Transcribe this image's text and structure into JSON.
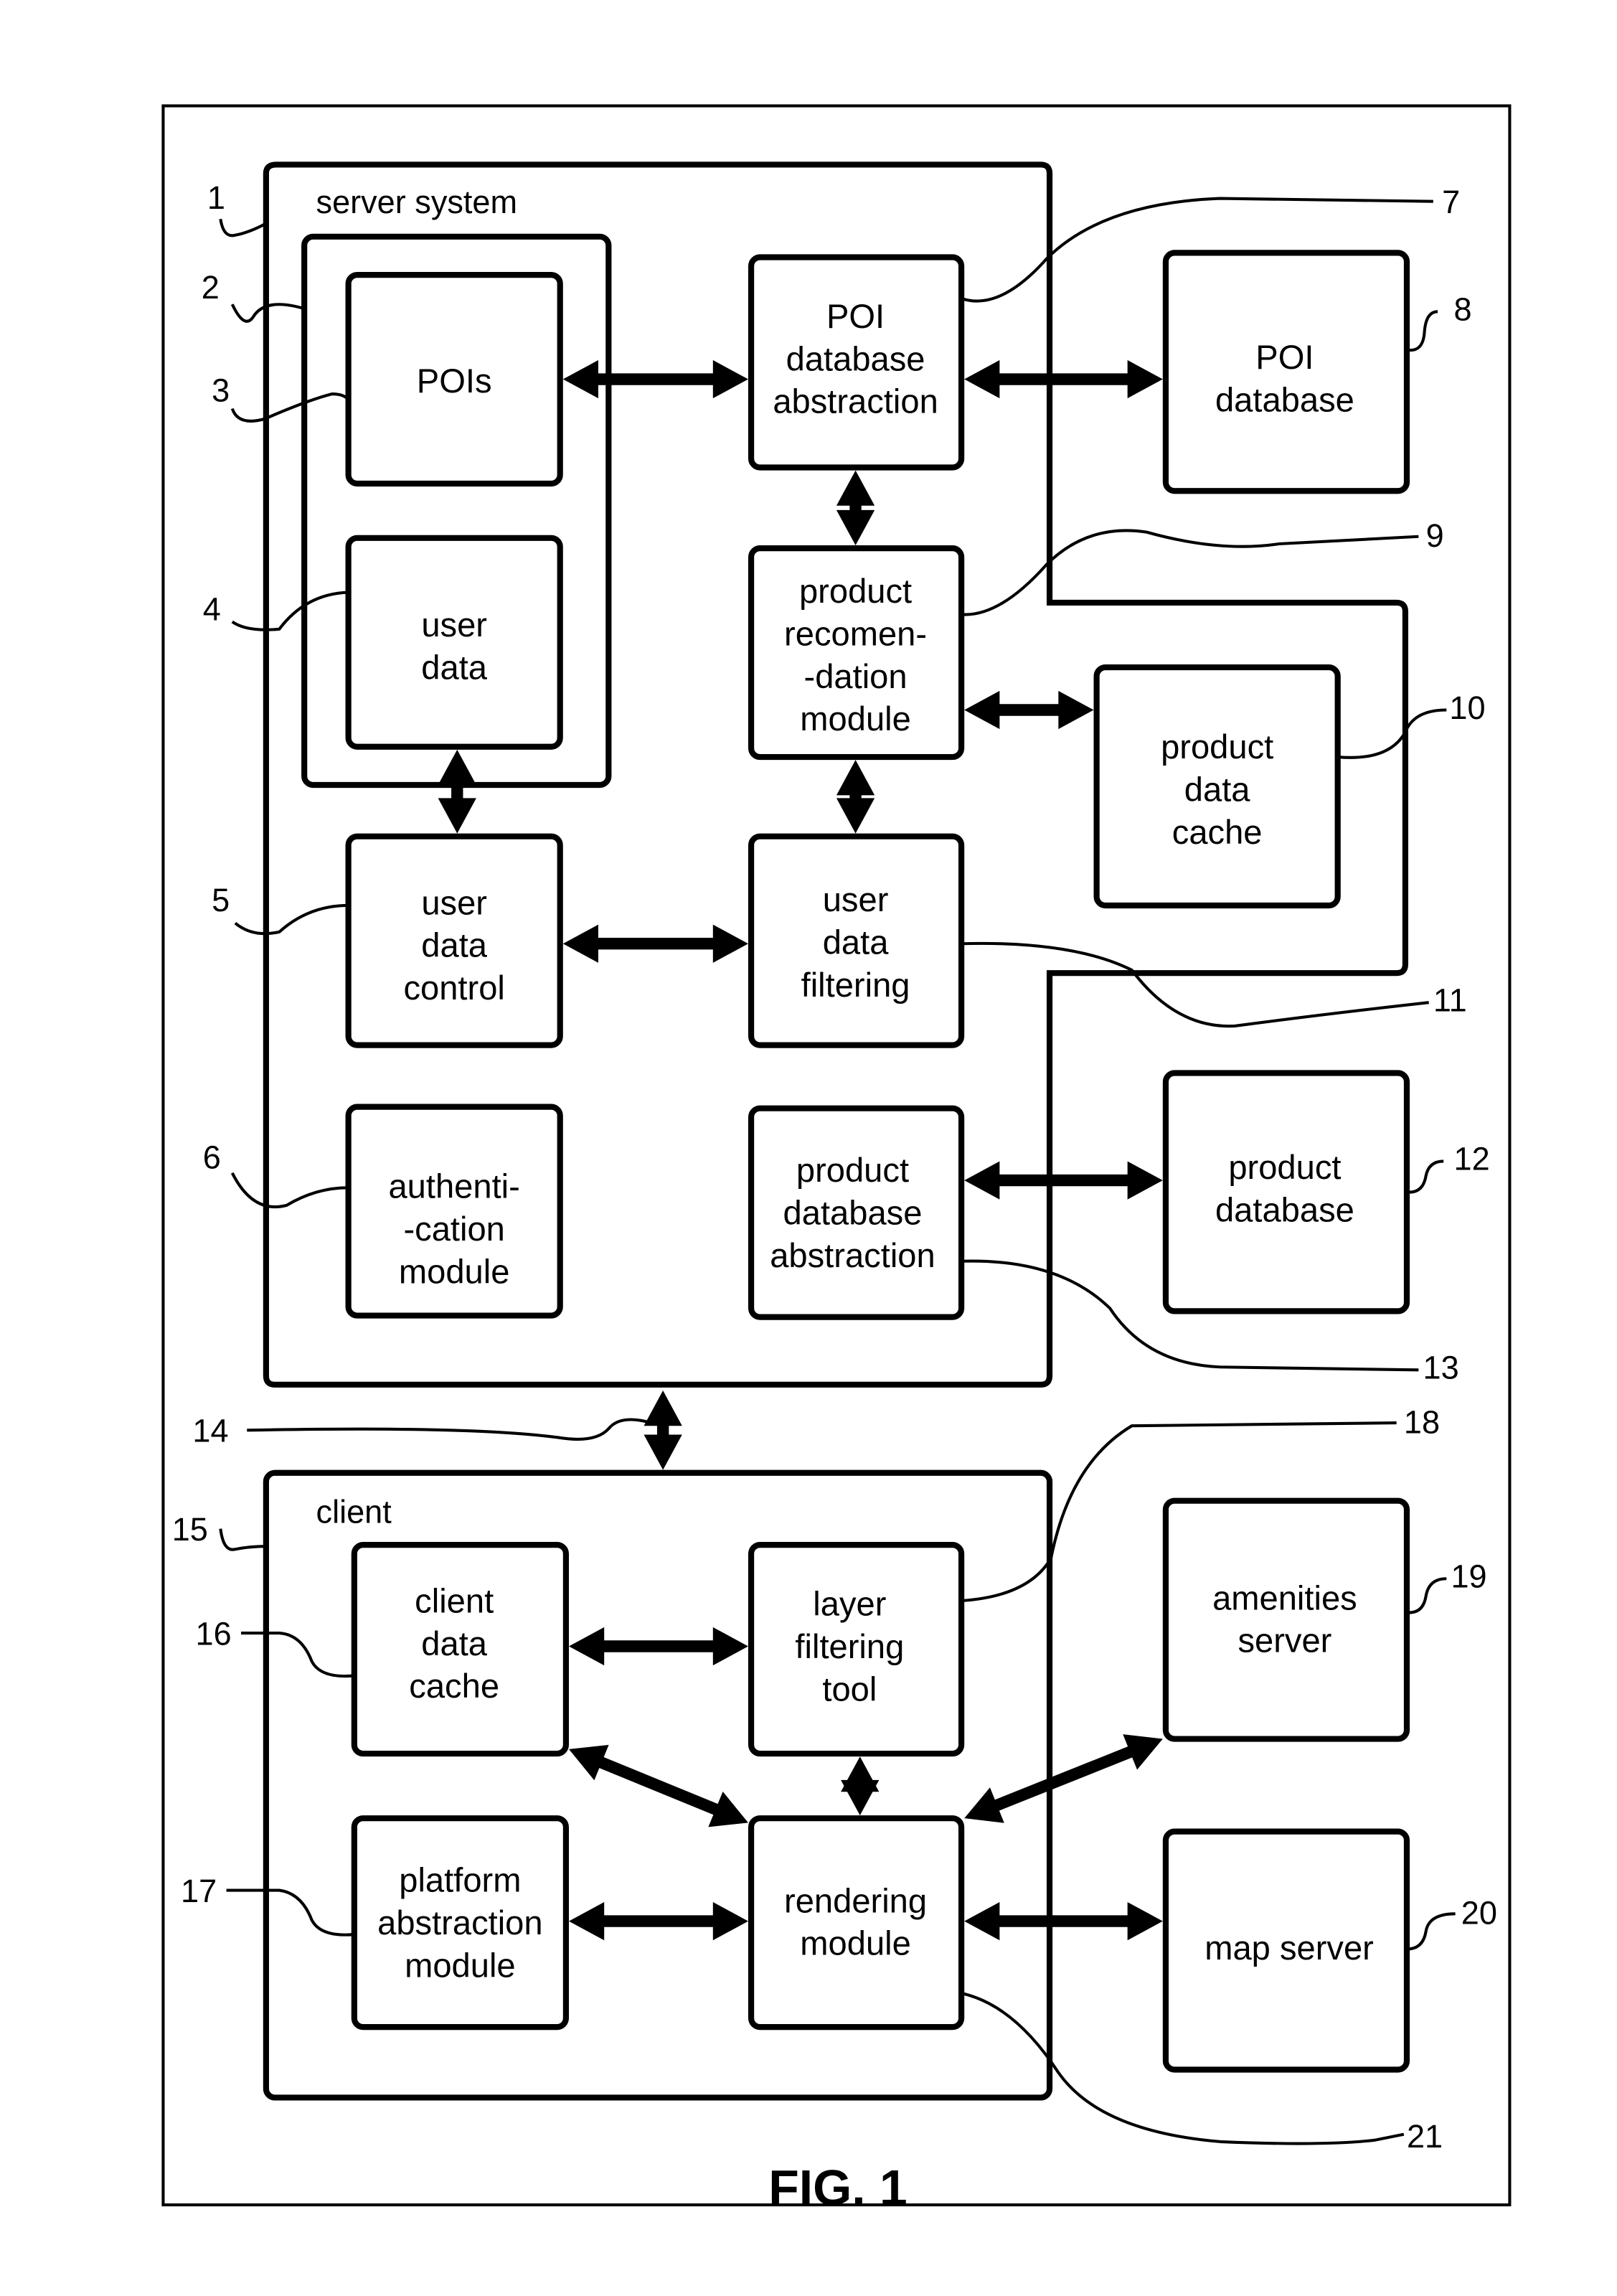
{
  "figure_title": "FIG. 1",
  "containers": {
    "server_system": {
      "label": "server system",
      "ref": "1"
    },
    "server_data_group": {
      "ref": "2"
    },
    "client": {
      "label": "client",
      "ref": "15"
    }
  },
  "boxes": {
    "pois": {
      "lines": [
        "POIs"
      ],
      "ref": "3"
    },
    "user_data": {
      "lines": [
        "user",
        "data"
      ],
      "ref": "4"
    },
    "user_data_control": {
      "lines": [
        "user",
        "data",
        "control"
      ],
      "ref": "5"
    },
    "authentication_module": {
      "lines": [
        "authenti-",
        "-cation",
        "module"
      ],
      "ref": "6"
    },
    "poi_database_abstraction": {
      "lines": [
        "POI",
        "database",
        "abstraction"
      ],
      "ref": "7"
    },
    "poi_database": {
      "lines": [
        "POI",
        "database"
      ],
      "ref": "8"
    },
    "product_recommendation_module": {
      "lines": [
        "product",
        "recomen-",
        "-dation",
        "module"
      ],
      "ref": "9"
    },
    "product_data_cache": {
      "lines": [
        "product",
        "data",
        "cache"
      ],
      "ref": "10"
    },
    "user_data_filtering": {
      "lines": [
        "user",
        "data",
        "filtering"
      ],
      "ref": "11"
    },
    "product_database": {
      "lines": [
        "product",
        "database"
      ],
      "ref": "12"
    },
    "product_database_abstraction": {
      "lines": [
        "product",
        "database",
        "abstraction"
      ],
      "ref": "13"
    },
    "client_data_cache": {
      "lines": [
        "client",
        "data",
        "cache"
      ],
      "ref": "16"
    },
    "platform_abstraction_module": {
      "lines": [
        "platform",
        "abstraction",
        "module"
      ],
      "ref": "17"
    },
    "layer_filtering_tool": {
      "lines": [
        "layer",
        "filtering",
        "tool"
      ],
      "ref": "18"
    },
    "amenities_server": {
      "lines": [
        "amenities",
        "server"
      ],
      "ref": "19"
    },
    "map_server": {
      "lines": [
        "map server"
      ],
      "ref": "20"
    },
    "rendering_module": {
      "lines": [
        "rendering",
        "module"
      ],
      "ref": "21"
    }
  },
  "links": {
    "server_client_ref": "14"
  }
}
